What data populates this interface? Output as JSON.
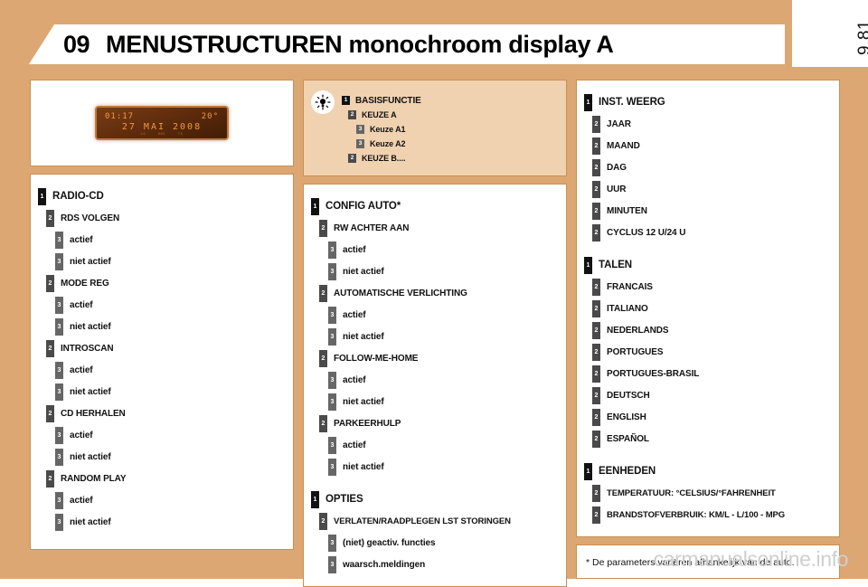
{
  "header": {
    "chapter": "09",
    "title": "MENUSTRUCTUREN monochroom display A",
    "page_number": "9.81"
  },
  "watermark": "carmanualsonline.info",
  "display": {
    "time": "01:17",
    "temperature": "20°",
    "date": "27 MAI 2008",
    "indicators": [
      "LO",
      "RDS",
      "TA"
    ]
  },
  "legend": {
    "icon": "lightbulb-icon",
    "items": [
      {
        "level": 1,
        "label": "BASISFUNCTIE"
      },
      {
        "level": 2,
        "label": "KEUZE A"
      },
      {
        "level": 3,
        "label": "Keuze A1"
      },
      {
        "level": 3,
        "label": "Keuze A2"
      },
      {
        "level": 2,
        "label": "KEUZE B...."
      }
    ]
  },
  "columns": [
    {
      "id": "left",
      "cards": [
        {
          "id": "radio-cd",
          "items": [
            {
              "level": 1,
              "label": "RADIO-CD"
            },
            {
              "level": 2,
              "label": "RDS VOLGEN"
            },
            {
              "level": 3,
              "label": "actief"
            },
            {
              "level": 3,
              "label": "niet actief"
            },
            {
              "level": 2,
              "label": "MODE REG"
            },
            {
              "level": 3,
              "label": "actief"
            },
            {
              "level": 3,
              "label": "niet actief"
            },
            {
              "level": 2,
              "label": "INTROSCAN"
            },
            {
              "level": 3,
              "label": "actief"
            },
            {
              "level": 3,
              "label": "niet actief"
            },
            {
              "level": 2,
              "label": "CD HERHALEN"
            },
            {
              "level": 3,
              "label": "actief"
            },
            {
              "level": 3,
              "label": "niet actief"
            },
            {
              "level": 2,
              "label": "RANDOM PLAY"
            },
            {
              "level": 3,
              "label": "actief"
            },
            {
              "level": 3,
              "label": "niet actief"
            }
          ]
        }
      ]
    },
    {
      "id": "middle",
      "cards": [
        {
          "id": "config-auto",
          "items": [
            {
              "level": 1,
              "label": "CONFIG AUTO*"
            },
            {
              "level": 2,
              "label": "RW ACHTER AAN"
            },
            {
              "level": 3,
              "label": "actief"
            },
            {
              "level": 3,
              "label": "niet actief"
            },
            {
              "level": 2,
              "label": "AUTOMATISCHE VERLICHTING"
            },
            {
              "level": 3,
              "label": "actief"
            },
            {
              "level": 3,
              "label": "niet actief"
            },
            {
              "level": 2,
              "label": "FOLLOW-ME-HOME"
            },
            {
              "level": 3,
              "label": "actief"
            },
            {
              "level": 3,
              "label": "niet actief"
            },
            {
              "level": 2,
              "label": "PARKEERHULP"
            },
            {
              "level": 3,
              "label": "actief"
            },
            {
              "level": 3,
              "label": "niet actief"
            },
            {
              "level": 1,
              "label": "OPTIES",
              "spaced": true
            },
            {
              "level": 2,
              "label": "VERLATEN/RAADPLEGEN LST STORINGEN"
            },
            {
              "level": 3,
              "label": "(niet) geactiv. functies"
            },
            {
              "level": 3,
              "label": "waarsch.meldingen"
            }
          ]
        }
      ]
    },
    {
      "id": "right",
      "cards": [
        {
          "id": "inst-weerg",
          "items": [
            {
              "level": 1,
              "label": "INST. WEERG"
            },
            {
              "level": 2,
              "label": "JAAR"
            },
            {
              "level": 2,
              "label": "MAAND"
            },
            {
              "level": 2,
              "label": "DAG"
            },
            {
              "level": 2,
              "label": "UUR"
            },
            {
              "level": 2,
              "label": "MINUTEN"
            },
            {
              "level": 2,
              "label": "CYCLUS 12 U/24 U"
            },
            {
              "level": 1,
              "label": "TALEN",
              "spaced": true
            },
            {
              "level": 2,
              "label": "FRANCAIS"
            },
            {
              "level": 2,
              "label": "ITALIANO"
            },
            {
              "level": 2,
              "label": "NEDERLANDS"
            },
            {
              "level": 2,
              "label": "PORTUGUES"
            },
            {
              "level": 2,
              "label": "PORTUGUES-BRASIL"
            },
            {
              "level": 2,
              "label": "DEUTSCH"
            },
            {
              "level": 2,
              "label": "ENGLISH"
            },
            {
              "level": 2,
              "label": "ESPAÑOL"
            },
            {
              "level": 1,
              "label": "EENHEDEN",
              "spaced": true
            },
            {
              "level": 2,
              "label": "TEMPERATUUR: °CELSIUS/°FAHRENHEIT"
            },
            {
              "level": 2,
              "label": "BRANDSTOFVERBRUIK: KM/L - L/100 - MPG"
            }
          ]
        }
      ]
    }
  ],
  "footnote": "* De parameters variëren afhankelijk van de auto."
}
